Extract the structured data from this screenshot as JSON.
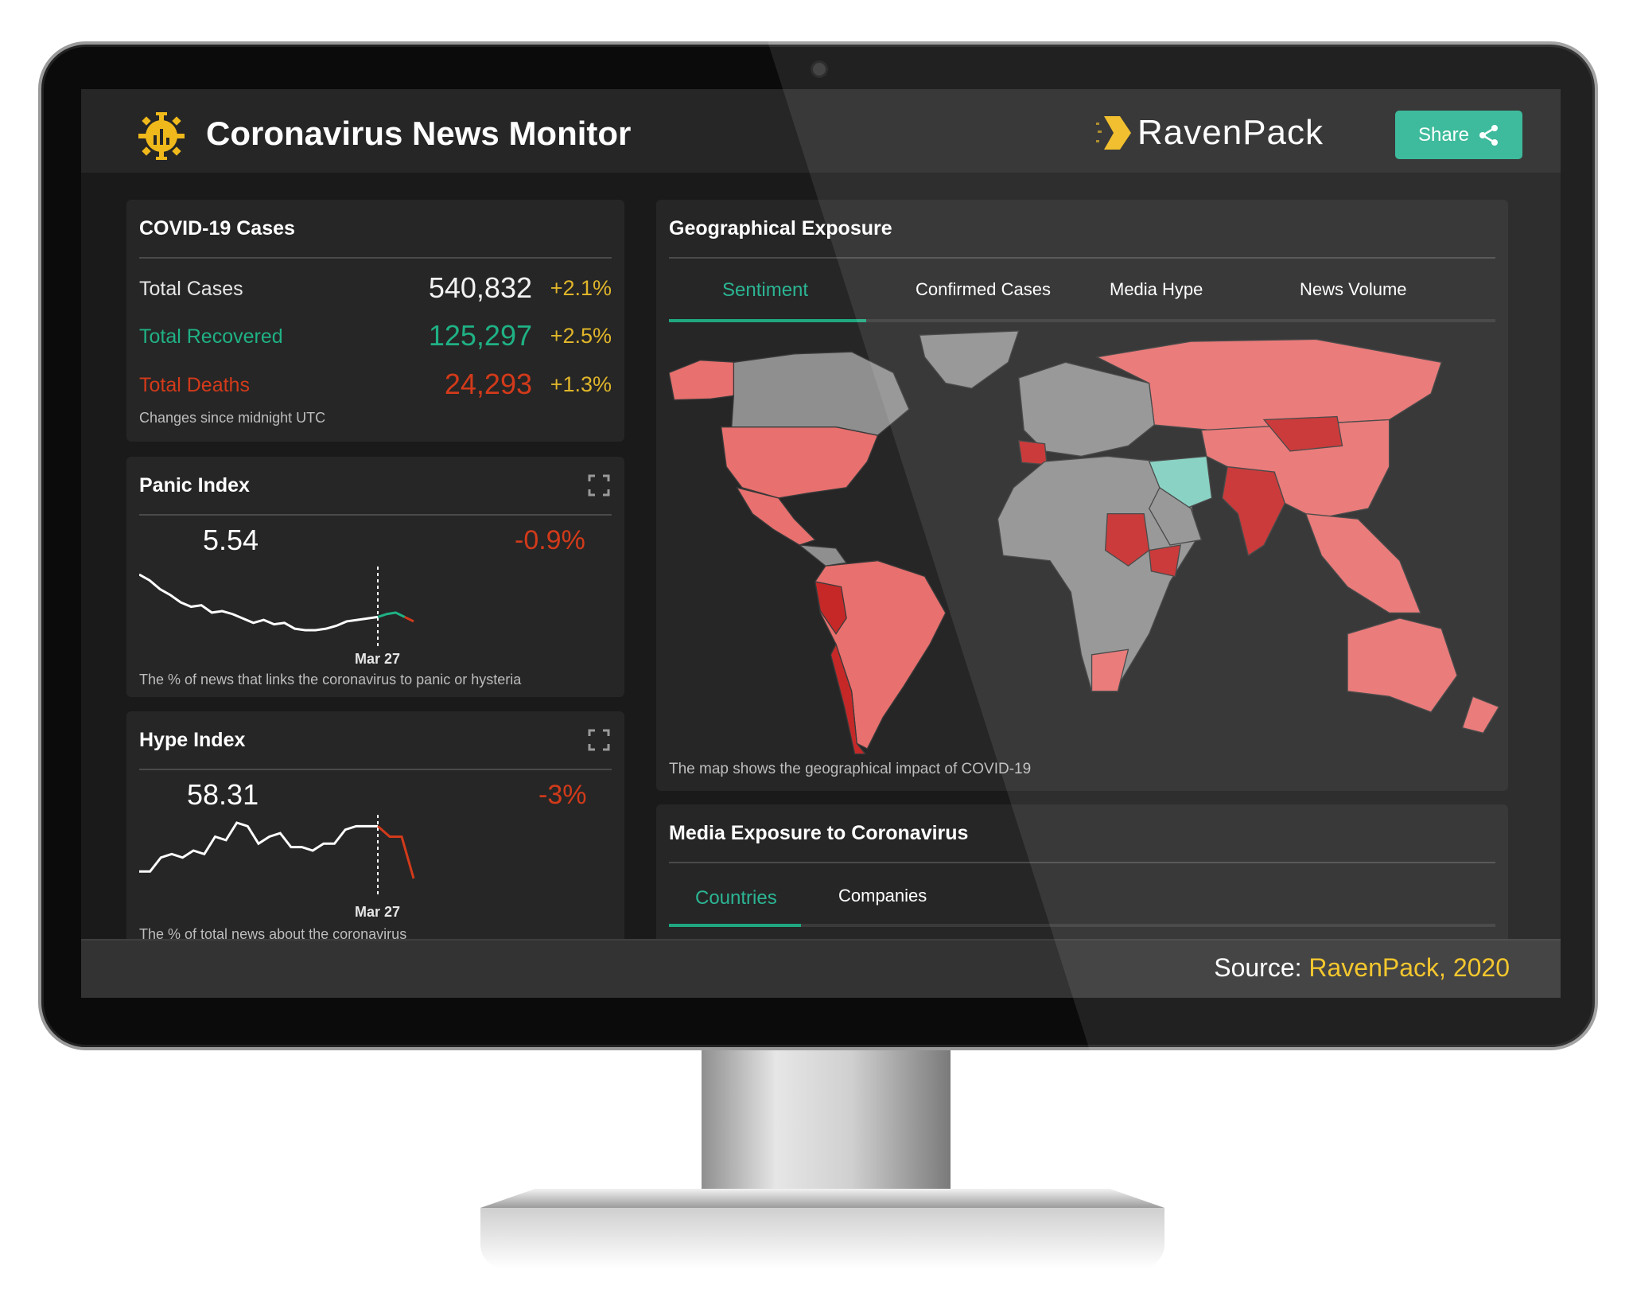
{
  "header": {
    "title": "Coronavirus News Monitor",
    "brand": "RavenPack",
    "share_label": "Share",
    "logo_icon": "virus-chart-icon",
    "share_icon": "share-icon"
  },
  "colors": {
    "accent": "#2bb593",
    "gold": "#f3c21a",
    "change": "#e0b52a",
    "recovered": "#1fb184",
    "deaths": "#d23a1a",
    "map_positive": "#e8706e",
    "map_negative": "#c62828",
    "map_neutral": "#8f8f8f",
    "map_teal": "#7fcfbf"
  },
  "cases": {
    "title": "COVID-19 Cases",
    "rows": [
      {
        "label": "Total Cases",
        "value": "540,832",
        "change": "+2.1%"
      },
      {
        "label": "Total Recovered",
        "value": "125,297",
        "change": "+2.5%"
      },
      {
        "label": "Total Deaths",
        "value": "24,293",
        "change": "+1.3%"
      }
    ],
    "note": "Changes since midnight UTC"
  },
  "panic": {
    "title": "Panic Index",
    "value": "5.54",
    "change": "-0.9%",
    "marker": "Mar 27",
    "note": "The % of news that links the coronavirus to panic or hysteria",
    "history": [
      9.0,
      8.6,
      8.0,
      7.6,
      7.1,
      6.8,
      6.9,
      6.4,
      6.5,
      6.3,
      6.0,
      5.7,
      5.9,
      5.6,
      5.7,
      5.3,
      5.2,
      5.2,
      5.3,
      5.5,
      5.8,
      5.9,
      6.0,
      6.1
    ],
    "forecast": [
      6.1,
      6.3,
      6.4,
      6.1,
      5.8
    ]
  },
  "hype": {
    "title": "Hype Index",
    "value": "58.31",
    "change": "-3%",
    "marker": "Mar 27",
    "note": "The % of total news about the coronavirus",
    "history": [
      50,
      50,
      54,
      55,
      54,
      56,
      55,
      60,
      59,
      64,
      63,
      58,
      60,
      61,
      57,
      57,
      56,
      58,
      58,
      62,
      63,
      63,
      63
    ],
    "forecast": [
      63,
      60,
      60,
      48
    ]
  },
  "geo": {
    "title": "Geographical Exposure",
    "tabs": [
      "Sentiment",
      "Confirmed Cases",
      "Media Hype",
      "News Volume"
    ],
    "active_tab": 0,
    "note": "The map shows the geographical impact of COVID-19"
  },
  "media": {
    "title": "Media Exposure to Coronavirus",
    "tabs": [
      "Countries",
      "Companies"
    ],
    "active_tab": 0
  },
  "footer": {
    "source_label": "Source:",
    "source_value": "RavenPack, 2020"
  }
}
